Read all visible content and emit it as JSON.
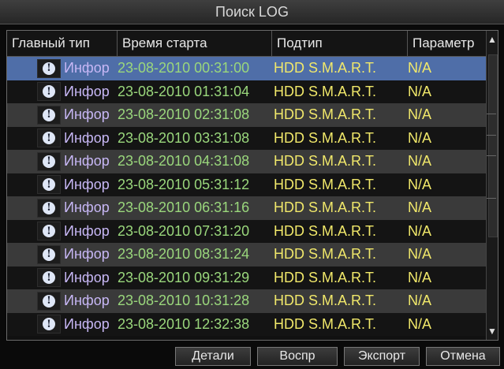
{
  "window": {
    "title": "Поиск LOG"
  },
  "table": {
    "columns": [
      "Главный тип",
      "Время старта",
      "Подтип",
      "Параметр"
    ],
    "rows": [
      {
        "main": "Инфор",
        "time": "23-08-2010 00:31:00",
        "sub": "HDD S.M.A.R.T.",
        "param": "N/A"
      },
      {
        "main": "Инфор",
        "time": "23-08-2010 01:31:04",
        "sub": "HDD S.M.A.R.T.",
        "param": "N/A"
      },
      {
        "main": "Инфор",
        "time": "23-08-2010 02:31:08",
        "sub": "HDD S.M.A.R.T.",
        "param": "N/A"
      },
      {
        "main": "Инфор",
        "time": "23-08-2010 03:31:08",
        "sub": "HDD S.M.A.R.T.",
        "param": "N/A"
      },
      {
        "main": "Инфор",
        "time": "23-08-2010 04:31:08",
        "sub": "HDD S.M.A.R.T.",
        "param": "N/A"
      },
      {
        "main": "Инфор",
        "time": "23-08-2010 05:31:12",
        "sub": "HDD S.M.A.R.T.",
        "param": "N/A"
      },
      {
        "main": "Инфор",
        "time": "23-08-2010 06:31:16",
        "sub": "HDD S.M.A.R.T.",
        "param": "N/A"
      },
      {
        "main": "Инфор",
        "time": "23-08-2010 07:31:20",
        "sub": "HDD S.M.A.R.T.",
        "param": "N/A"
      },
      {
        "main": "Инфор",
        "time": "23-08-2010 08:31:24",
        "sub": "HDD S.M.A.R.T.",
        "param": "N/A"
      },
      {
        "main": "Инфор",
        "time": "23-08-2010 09:31:29",
        "sub": "HDD S.M.A.R.T.",
        "param": "N/A"
      },
      {
        "main": "Инфор",
        "time": "23-08-2010 10:31:28",
        "sub": "HDD S.M.A.R.T.",
        "param": "N/A"
      },
      {
        "main": "Инфор",
        "time": "23-08-2010 12:32:38",
        "sub": "HDD S.M.A.R.T.",
        "param": "N/A"
      }
    ],
    "selected_row": 0,
    "row_icon": "info-icon"
  },
  "buttons": {
    "details": "Детали",
    "play": "Воспр",
    "export": "Экспорт",
    "cancel": "Отмена"
  },
  "colors": {
    "selected_row": "#4f6ea8",
    "main_type_text": "#c7b7f5",
    "time_text": "#9ad77c",
    "subtype_text": "#f1e86a"
  }
}
